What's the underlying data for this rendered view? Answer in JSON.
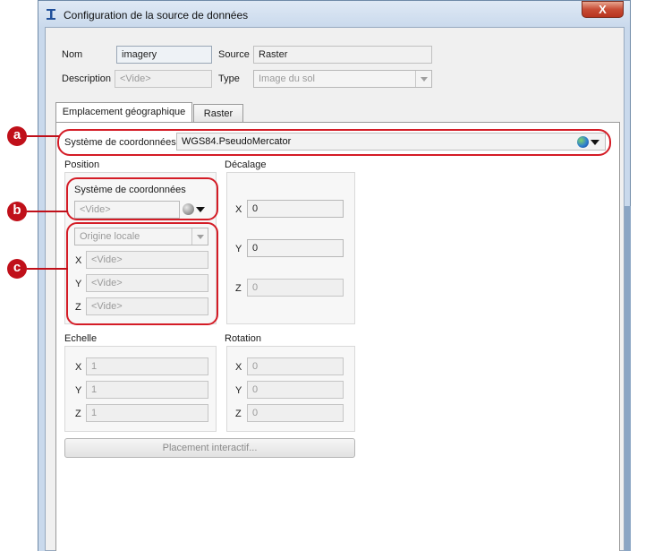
{
  "window": {
    "title": "Configuration de la source de données",
    "close_glyph": "X"
  },
  "header": {
    "nom_label": "Nom",
    "nom_value": "imagery",
    "source_label": "Source",
    "source_value": "Raster",
    "description_label": "Description",
    "description_placeholder": "<Vide>",
    "type_label": "Type",
    "type_value": "Image du sol"
  },
  "tabs": [
    {
      "label": "Emplacement géographique",
      "active": true
    },
    {
      "label": "Raster",
      "active": false
    }
  ],
  "crs": {
    "label": "Système de coordonnées",
    "value": "WGS84.PseudoMercator",
    "icon": "globe-icon"
  },
  "position": {
    "label": "Position",
    "crs_label": "Système de coordonnées",
    "crs_placeholder": "<Vide>",
    "origin_value": "Origine locale",
    "x_label": "X",
    "x_placeholder": "<Vide>",
    "y_label": "Y",
    "y_placeholder": "<Vide>",
    "z_label": "Z",
    "z_placeholder": "<Vide>"
  },
  "offset": {
    "label": "Décalage",
    "x_label": "X",
    "x_value": "0",
    "y_label": "Y",
    "y_value": "0",
    "z_label": "Z",
    "z_value": "0"
  },
  "scale": {
    "label": "Echelle",
    "x_label": "X",
    "x_value": "1",
    "y_label": "Y",
    "y_value": "1",
    "z_label": "Z",
    "z_value": "1"
  },
  "rotation": {
    "label": "Rotation",
    "x_label": "X",
    "x_value": "0",
    "y_label": "Y",
    "y_value": "0",
    "z_label": "Z",
    "z_value": "0"
  },
  "placement_button": "Placement interactif...",
  "callouts": {
    "a": "a",
    "b": "b",
    "c": "c"
  },
  "colors": {
    "callout": "#c0101a",
    "frame": "#c9d9ec",
    "close": "#c74c35"
  }
}
